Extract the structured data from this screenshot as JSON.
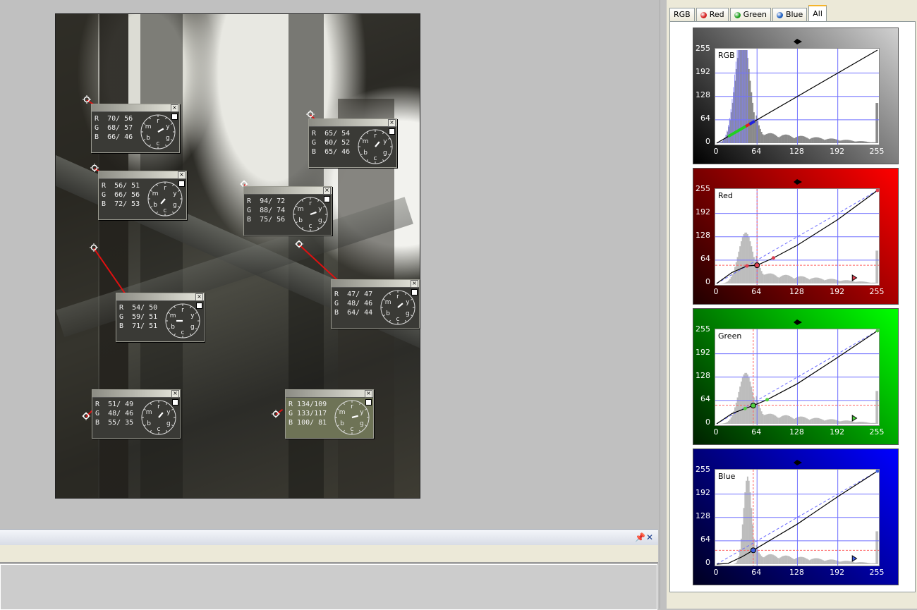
{
  "side_panel": {
    "tabs": [
      {
        "label": "RGB",
        "icon": "none",
        "active": false
      },
      {
        "label": "Red",
        "icon": "red-ball-icon",
        "color": "#d42020",
        "active": false
      },
      {
        "label": "Green",
        "icon": "green-ball-icon",
        "color": "#20a020",
        "active": false
      },
      {
        "label": "Blue",
        "icon": "blue-ball-icon",
        "color": "#2060c0",
        "active": false
      },
      {
        "label": "All",
        "icon": "none",
        "active": true
      }
    ]
  },
  "curves": [
    {
      "name": "RGB",
      "label": "RGB",
      "bg_from": "#000000",
      "bg_to": "#d0d0d0",
      "accent": "#000000",
      "curve": [
        [
          0,
          0
        ],
        [
          255,
          255
        ]
      ],
      "identity": false,
      "guide": null
    },
    {
      "name": "Red",
      "label": "Red",
      "bg_from": "#200000",
      "bg_to": "#ff0000",
      "accent": "#e04050",
      "curve": [
        [
          0,
          0
        ],
        [
          24,
          30
        ],
        [
          48,
          48
        ],
        [
          64,
          50
        ],
        [
          90,
          70
        ],
        [
          128,
          105
        ],
        [
          192,
          175
        ],
        [
          255,
          255
        ]
      ],
      "identity": true,
      "guide": {
        "x": 64,
        "y": 50
      },
      "points": [
        [
          48,
          48
        ],
        [
          64,
          50
        ],
        [
          90,
          70
        ],
        [
          255,
          255
        ]
      ]
    },
    {
      "name": "Green",
      "label": "Green",
      "bg_from": "#002000",
      "bg_to": "#00ff00",
      "accent": "#50d040",
      "curve": [
        [
          0,
          0
        ],
        [
          24,
          28
        ],
        [
          45,
          42
        ],
        [
          58,
          50
        ],
        [
          80,
          66
        ],
        [
          128,
          110
        ],
        [
          192,
          182
        ],
        [
          255,
          255
        ]
      ],
      "identity": true,
      "guide": {
        "x": 58,
        "y": 51
      },
      "points": [
        [
          45,
          42
        ],
        [
          58,
          50
        ],
        [
          80,
          66
        ],
        [
          255,
          255
        ]
      ]
    },
    {
      "name": "Blue",
      "label": "Blue",
      "bg_from": "#000020",
      "bg_to": "#0000ff",
      "accent": "#4060e0",
      "curve": [
        [
          0,
          0
        ],
        [
          18,
          2
        ],
        [
          40,
          20
        ],
        [
          58,
          38
        ],
        [
          128,
          110
        ],
        [
          192,
          185
        ],
        [
          255,
          255
        ]
      ],
      "identity": true,
      "guide": {
        "x": 58,
        "y": 38
      },
      "points": [
        [
          58,
          38
        ],
        [
          255,
          255
        ]
      ]
    }
  ],
  "axis": {
    "ticks": [
      "0",
      "64",
      "128",
      "192",
      "255"
    ],
    "tick_values": [
      0,
      64,
      128,
      192,
      255
    ]
  },
  "probes": [
    {
      "r": "70/ 56",
      "g": "68/ 57",
      "b": "66/ 46",
      "angle": -30,
      "olive": false
    },
    {
      "r": "65/ 54",
      "g": "60/ 52",
      "b": "65/ 46",
      "angle": -50,
      "olive": false
    },
    {
      "r": "56/ 51",
      "g": "66/ 56",
      "b": "72/ 53",
      "angle": 130,
      "olive": false
    },
    {
      "r": "94/ 72",
      "g": "88/ 74",
      "b": "75/ 56",
      "angle": -20,
      "olive": false
    },
    {
      "r": "54/ 50",
      "g": "59/ 51",
      "b": "71/ 51",
      "angle": 180,
      "olive": false
    },
    {
      "r": "47/ 47",
      "g": "48/ 46",
      "b": "64/ 44",
      "angle": -40,
      "olive": false
    },
    {
      "r": "51/ 49",
      "g": "48/ 46",
      "b": "55/ 35",
      "angle": -50,
      "olive": false
    },
    {
      "r": "134/109",
      "g": "133/117",
      "b": "100/ 81",
      "angle": -15,
      "olive": true
    }
  ],
  "dial_labels": [
    "r",
    "y",
    "g",
    "c",
    "b",
    "m"
  ],
  "row_labels": [
    "R",
    "G",
    "B"
  ],
  "dock": {
    "pin_icon": "pin-icon",
    "close_label": "✕"
  }
}
